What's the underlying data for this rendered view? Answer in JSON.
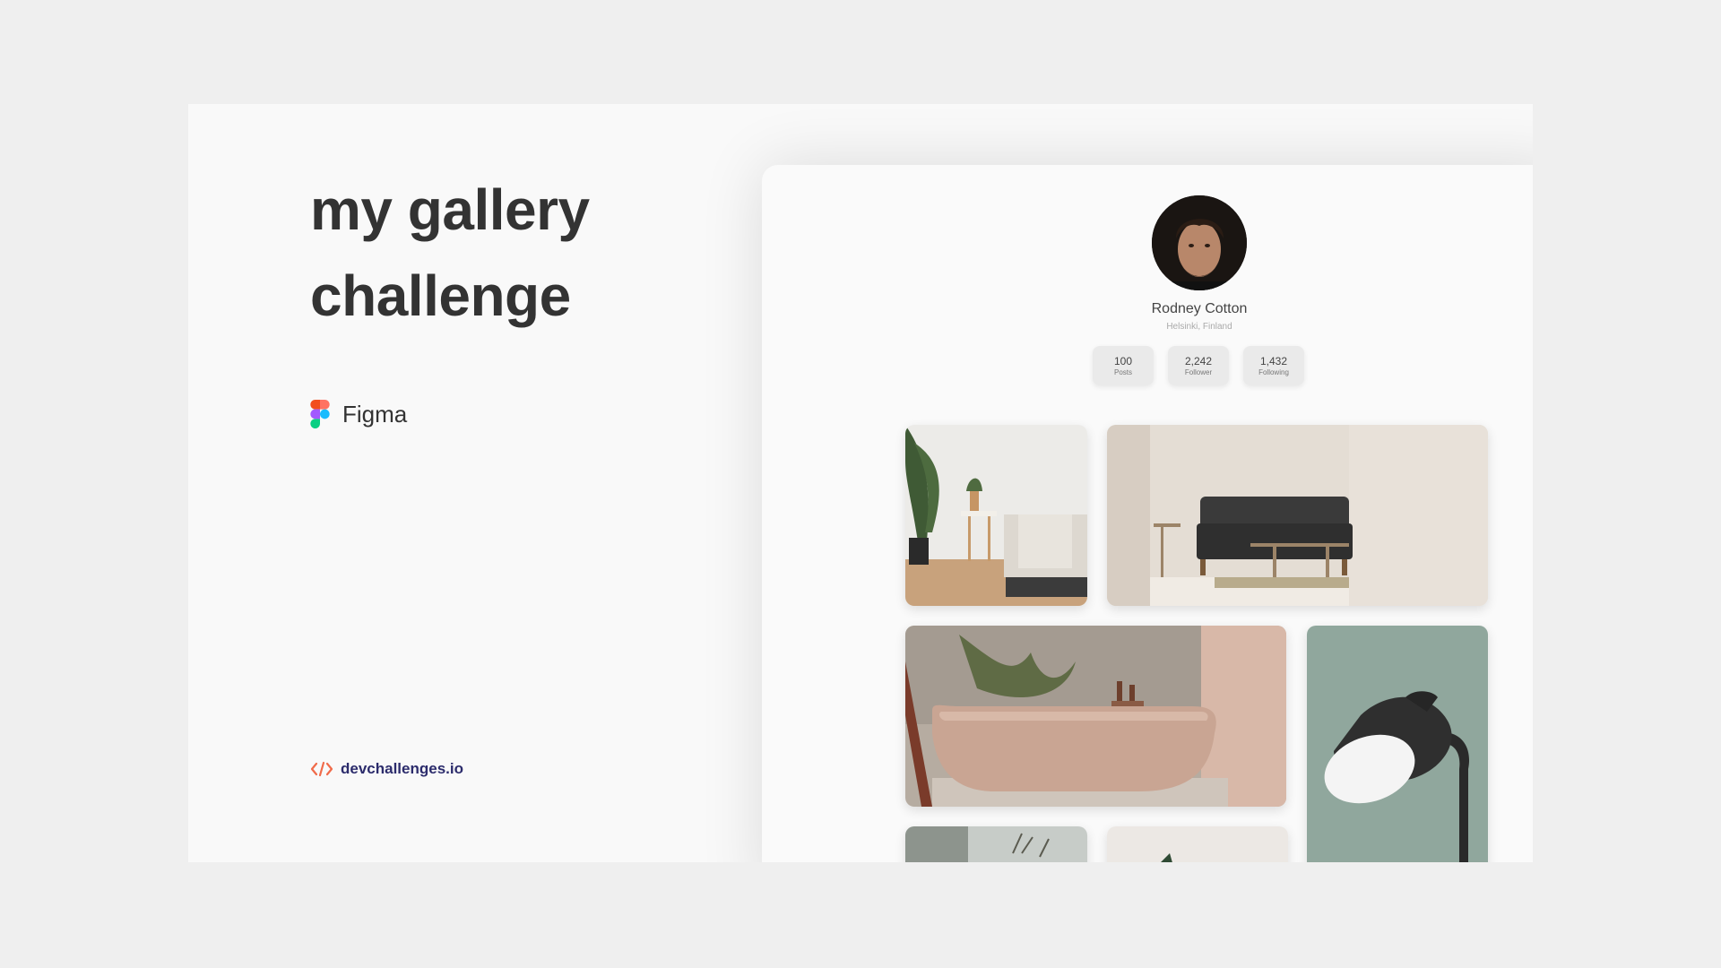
{
  "title": {
    "line1": "my gallery",
    "line2": "challenge"
  },
  "tool": {
    "icon": "figma-icon",
    "label": "Figma"
  },
  "brand": {
    "icon": "code-brackets-icon",
    "label": "devchallenges.io",
    "color": "#2c2c6c",
    "accent": "#f06b4a"
  },
  "profile": {
    "name": "Rodney Cotton",
    "location": "Helsinki, Finland",
    "stats": [
      {
        "value": "100",
        "label": "Posts"
      },
      {
        "value": "2,242",
        "label": "Follower"
      },
      {
        "value": "1,432",
        "label": "Following"
      }
    ]
  },
  "gallery": {
    "photos": [
      "bedroom-photo",
      "living-room-sofa-photo",
      "bathtub-photo",
      "lamp-photo",
      "plants-photo",
      "decor-photo"
    ]
  }
}
